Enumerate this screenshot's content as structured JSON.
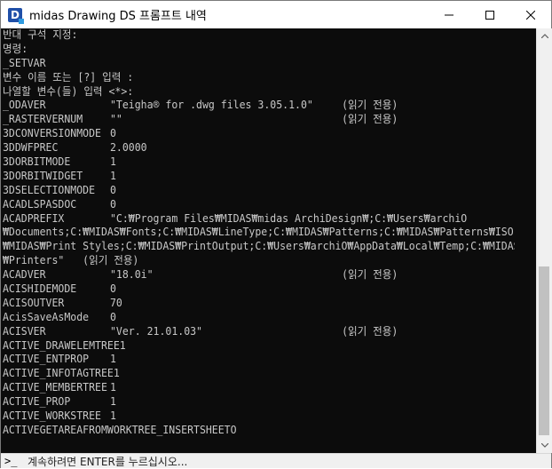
{
  "window": {
    "title": "midas Drawing DS 프롬프트 내역",
    "app_icon_letter": "D"
  },
  "console": {
    "lines": [
      {
        "a": "반대 구석 지정:",
        "b": "",
        "c": ""
      },
      {
        "a": "명령:",
        "b": "",
        "c": ""
      },
      {
        "a": "_SETVAR",
        "b": "",
        "c": ""
      },
      {
        "a": "변수 이름 또는 [?] 입력 :",
        "b": "",
        "c": ""
      },
      {
        "a": "나열할 변수(들) 입력 <*>:",
        "b": "",
        "c": ""
      },
      {
        "a": "_ODAVER",
        "b": "\"Teigha® for .dwg files 3.05.1.0\"",
        "c": "(읽기 전용)"
      },
      {
        "a": "_RASTERVERNUM",
        "b": "\"\"",
        "c": "(읽기 전용)"
      },
      {
        "a": "3DCONVERSIONMODE",
        "b": "0",
        "c": ""
      },
      {
        "a": "3DDWFPREC",
        "b": "2.0000",
        "c": ""
      },
      {
        "a": "3DORBITMODE",
        "b": "1",
        "c": ""
      },
      {
        "a": "3DORBITWIDGET",
        "b": "1",
        "c": ""
      },
      {
        "a": "3DSELECTIONMODE",
        "b": "0",
        "c": ""
      },
      {
        "a": "ACADLSPASDOC",
        "b": "0",
        "c": ""
      },
      {
        "a": "ACADPREFIX",
        "b": "\"C:₩Program Files₩MIDAS₩midas ArchiDesign₩;C:₩Users₩archiO",
        "c": ""
      },
      {
        "a": "₩Documents;C:₩MIDAS₩Fonts;C:₩MIDAS₩LineType;C:₩MIDAS₩Patterns;C:₩MIDAS₩Patterns₩ISO;C:",
        "b": "",
        "c": ""
      },
      {
        "a": "₩MIDAS₩Print Styles;C:₩MIDAS₩PrintOutput;C:₩Users₩archiO₩AppData₩Local₩Temp;C:₩MIDAS",
        "b": "",
        "c": ""
      },
      {
        "a": "₩Printers\"   (읽기 전용)",
        "b": "",
        "c": ""
      },
      {
        "a": "ACADVER",
        "b": "\"18.0i\"",
        "c": "(읽기 전용)"
      },
      {
        "a": "ACISHIDEMODE",
        "b": "0",
        "c": ""
      },
      {
        "a": "ACISOUTVER",
        "b": "70",
        "c": ""
      },
      {
        "a": "AcisSaveAsMode",
        "b": "0",
        "c": ""
      },
      {
        "a": "ACISVER",
        "b": "\"Ver. 21.01.03\"",
        "c": "(읽기 전용)"
      },
      {
        "a": "ACTIVE_DRAWELEMTREE1",
        "b": "",
        "c": ""
      },
      {
        "a": "ACTIVE_ENTPROP",
        "b": "1",
        "c": ""
      },
      {
        "a": "ACTIVE_INFOTAGTREE1",
        "b": "",
        "c": ""
      },
      {
        "a": "ACTIVE_MEMBERTREE",
        "b": "1",
        "c": ""
      },
      {
        "a": "ACTIVE_PROP",
        "b": "1",
        "c": ""
      },
      {
        "a": "ACTIVE_WORKSTREE",
        "b": "1",
        "c": ""
      },
      {
        "a": "ACTIVEGETAREAFROMWORKTREE_INSERTSHEETO",
        "b": "",
        "c": ""
      }
    ]
  },
  "statusbar": {
    "prompt_symbol": ">_",
    "message": "계속하려면 ENTER를 누르십시오..."
  },
  "colors": {
    "console_bg": "#0c0c0c",
    "console_text": "#c8c8c8",
    "accent": "#1f4fa8"
  }
}
